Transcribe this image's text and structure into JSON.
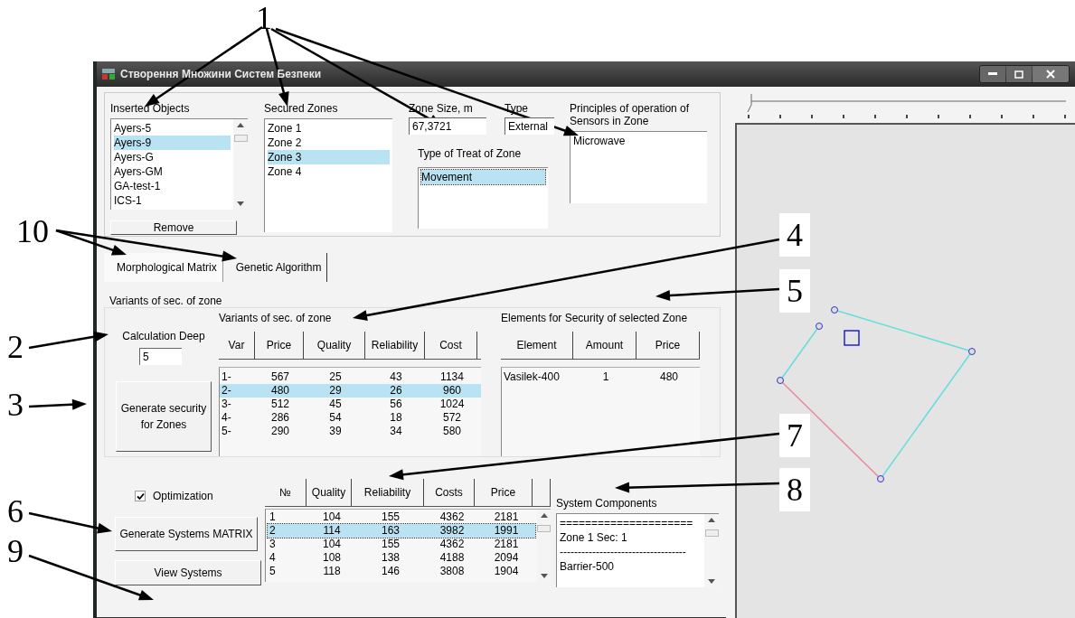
{
  "window": {
    "title": "Створення Множини Систем Безпеки"
  },
  "inserted_objects": {
    "label": "Inserted Objects",
    "items": [
      {
        "text": "Ayers-5",
        "selected": false
      },
      {
        "text": "Ayers-9",
        "selected": true
      },
      {
        "text": "Ayers-G",
        "selected": false
      },
      {
        "text": "Ayers-GM",
        "selected": false
      },
      {
        "text": "GA-test-1",
        "selected": false
      },
      {
        "text": "ICS-1",
        "selected": false
      }
    ],
    "button": "Remove"
  },
  "secured_zones": {
    "label": "Secured Zones",
    "items": [
      {
        "text": "Zone 1",
        "selected": false
      },
      {
        "text": "Zone 2",
        "selected": false
      },
      {
        "text": "Zone 3",
        "selected": true
      },
      {
        "text": "Zone 4",
        "selected": false
      }
    ]
  },
  "zone_size": {
    "label": "Zone Size, m",
    "value": "67,3721"
  },
  "type": {
    "label": "Type",
    "value": "External"
  },
  "treat": {
    "label": "Type of Treat of Zone",
    "items": [
      {
        "text": "Movement",
        "selected": true
      }
    ]
  },
  "principles": {
    "label": "Principles of operation of Sensors in Zone",
    "items": [
      {
        "text": "Microwave",
        "selected": false
      }
    ]
  },
  "tabs": [
    {
      "label": "Morphological Matrix",
      "selected": true
    },
    {
      "label": "Genetic Algorithm",
      "selected": false
    }
  ],
  "variants_group": {
    "title": "Variants of sec. of zone",
    "calc_label": "Calculation Deep",
    "calc_value": "5",
    "generate_button": "Generate security for Zones",
    "variants": {
      "label": "Variants of sec. of zone",
      "columns": [
        "Var",
        "Price",
        "Quality",
        "Reliability",
        "Cost"
      ],
      "rows": [
        {
          "cells": [
            "1-",
            "567",
            "25",
            "43",
            "1134"
          ],
          "selected": false
        },
        {
          "cells": [
            "2-",
            "480",
            "29",
            "26",
            "960"
          ],
          "selected": true
        },
        {
          "cells": [
            "3-",
            "512",
            "45",
            "56",
            "1024"
          ],
          "selected": false
        },
        {
          "cells": [
            "4-",
            "286",
            "54",
            "18",
            "572"
          ],
          "selected": false
        },
        {
          "cells": [
            "5-",
            "290",
            "39",
            "34",
            "580"
          ],
          "selected": false
        }
      ]
    },
    "elements": {
      "label": "Elements for Security of selected Zone",
      "columns": [
        "Element",
        "Amount",
        "Price"
      ],
      "rows": [
        {
          "cells": [
            "Vasilek-400",
            "1",
            "480"
          ],
          "selected": false
        }
      ]
    }
  },
  "optimization": {
    "label": "Optimization",
    "checked": true
  },
  "generate_systems_button": "Generate Systems MATRIX",
  "view_systems_button": "View Systems",
  "systems": {
    "columns": [
      "№",
      "Quality",
      "Reliability",
      "Costs",
      "Price"
    ],
    "rows": [
      {
        "cells": [
          "1",
          "104",
          "155",
          "4362",
          "2181"
        ],
        "selected": false
      },
      {
        "cells": [
          "2",
          "114",
          "163",
          "3982",
          "1991"
        ],
        "selected": true
      },
      {
        "cells": [
          "3",
          "104",
          "155",
          "4362",
          "2181"
        ],
        "selected": false
      },
      {
        "cells": [
          "4",
          "108",
          "138",
          "4188",
          "2094"
        ],
        "selected": false
      },
      {
        "cells": [
          "5",
          "118",
          "146",
          "3808",
          "1904"
        ],
        "selected": false
      }
    ]
  },
  "components": {
    "label": "System Components",
    "lines": [
      "=====================",
      "Zone 1    Sec: 1",
      "-----------------------------------",
      "Barrier-500"
    ]
  },
  "callouts": [
    {
      "label": "1"
    },
    {
      "label": "10"
    },
    {
      "label": "4"
    },
    {
      "label": "5"
    },
    {
      "label": "2"
    },
    {
      "label": "3"
    },
    {
      "label": "7"
    },
    {
      "label": "8"
    },
    {
      "label": "6"
    },
    {
      "label": "9"
    }
  ]
}
